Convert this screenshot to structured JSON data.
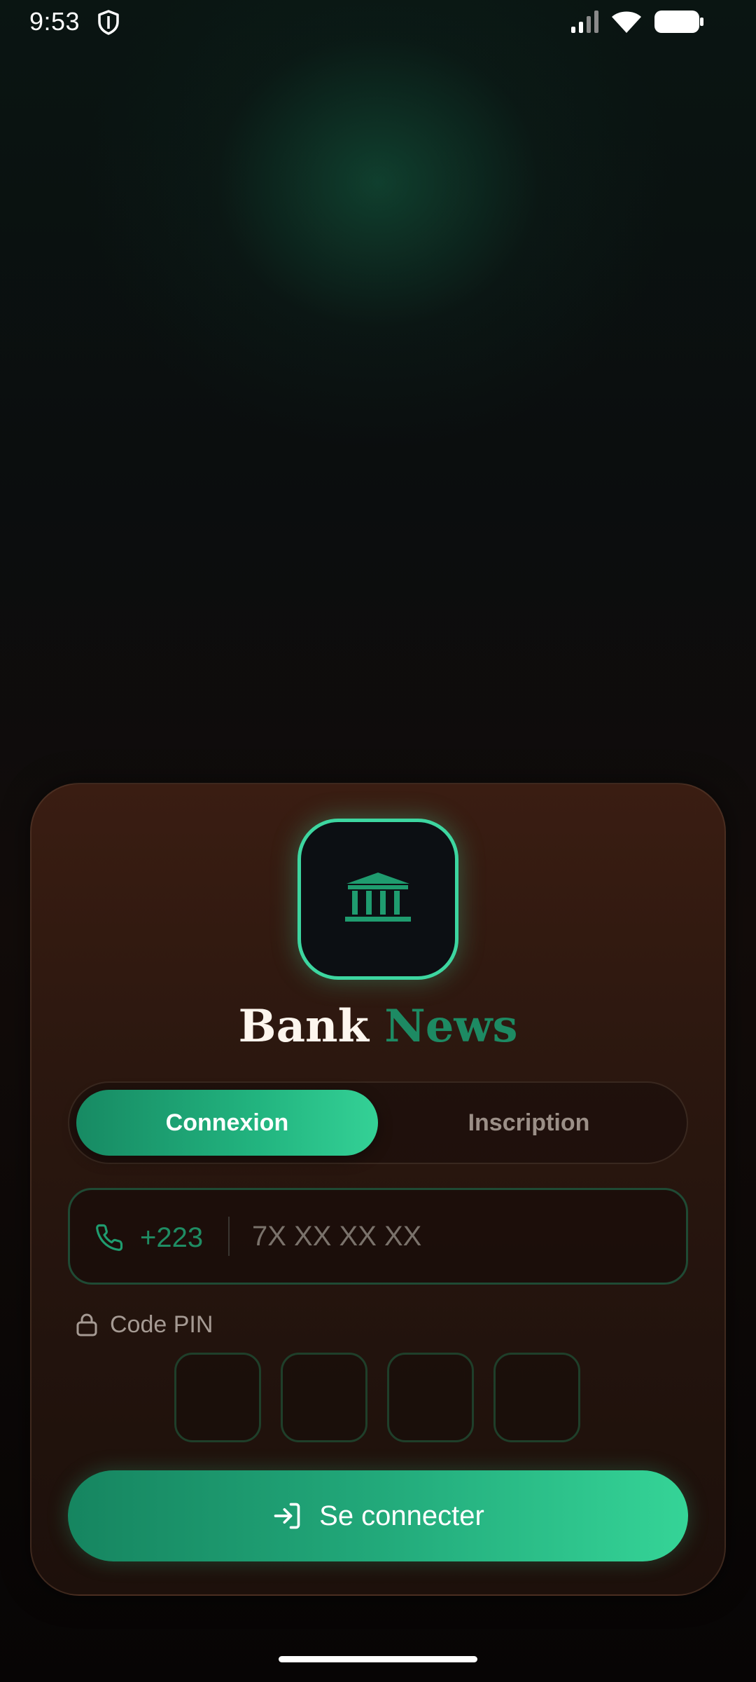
{
  "status_bar": {
    "time": "9:53"
  },
  "app": {
    "brand_word_1": "Bank",
    "brand_word_2": "News",
    "accent_color": "#3dd6a0",
    "brand_green": "#1d8a63"
  },
  "tabs": {
    "active": "Connexion",
    "inactive": "Inscription"
  },
  "phone": {
    "prefix": "+223",
    "placeholder": "7X XX XX XX",
    "value": ""
  },
  "pin": {
    "label": "Code PIN",
    "digits": [
      "",
      "",
      "",
      ""
    ]
  },
  "cta": {
    "label": "Se connecter"
  },
  "icons": {
    "status": [
      "shield-icon",
      "signal-icon",
      "wifi-icon",
      "battery-icon"
    ],
    "logo": "bank-icon",
    "phone": "phone-icon",
    "pin": "lock-icon",
    "cta": "login-icon"
  }
}
